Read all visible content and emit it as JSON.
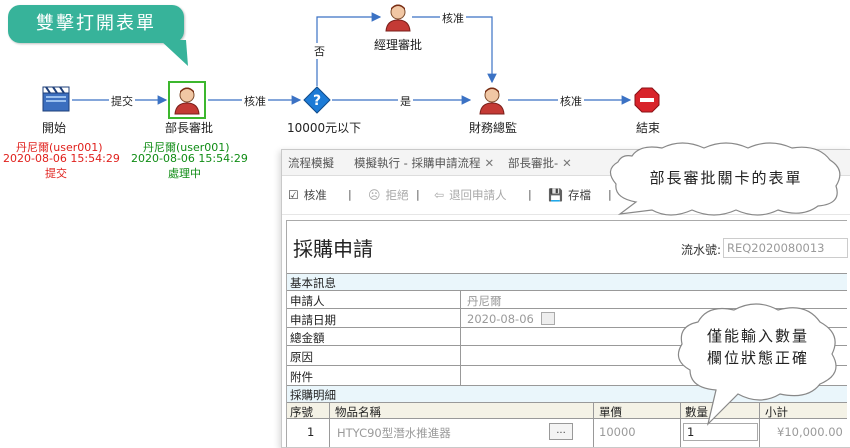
{
  "callout_top": "雙擊打開表單",
  "flow": {
    "nodes": {
      "start": "開始",
      "dept_head": "部長審批",
      "condition": "10000元以下",
      "manager": "經理審批",
      "finance": "財務總監",
      "end": "結束"
    },
    "edges": {
      "submit": "提交",
      "approve1": "核准",
      "no": "否",
      "yes": "是",
      "approve2": "核准",
      "approve3": "核准"
    },
    "start_status": {
      "user": "丹尼爾(user001)",
      "time": "2020-08-06 15:54:29",
      "action": "提交"
    },
    "dept_status": {
      "user": "丹尼爾(user001)",
      "time": "2020-08-06 15:54:29",
      "action": "處理中"
    }
  },
  "tabs": [
    {
      "label": "流程模擬"
    },
    {
      "label": "模擬執行 - 採購申請流程"
    },
    {
      "label": "部長審批-"
    }
  ],
  "toolbar": {
    "approve": "核准",
    "reject": "拒絕",
    "return": "退回申請人",
    "save": "存檔"
  },
  "form": {
    "title": "採購申請",
    "serial_label": "流水號:",
    "serial_value": "REQ2020080013",
    "section_basic": "基本訊息",
    "applicant_label": "申請人",
    "applicant_value": "丹尼爾",
    "date_label": "申請日期",
    "date_value": "2020-08-06",
    "total_label": "總金額",
    "reason_label": "原因",
    "attachment_label": "附件",
    "section_detail": "採購明細",
    "columns": [
      "序號",
      "物品名稱",
      "單價",
      "數量",
      "小計"
    ],
    "rows": [
      {
        "no": "1",
        "name": "HTYC90型潛水推進器",
        "btn": "...",
        "price": "10000",
        "qty": "1",
        "subtotal": "¥10,000.00"
      }
    ]
  },
  "bubble_form": "部長審批關卡的表單",
  "bubble_qty": [
    "僅能輸入數量",
    "欄位狀態正確"
  ],
  "colors": {
    "callout_green": "#37b39a",
    "status_red": "#e0201c",
    "status_green": "#0f8c14",
    "condition_blue": "#1d7bd6",
    "end_red": "#d8232a",
    "highlight_border": "#3cb72e"
  }
}
